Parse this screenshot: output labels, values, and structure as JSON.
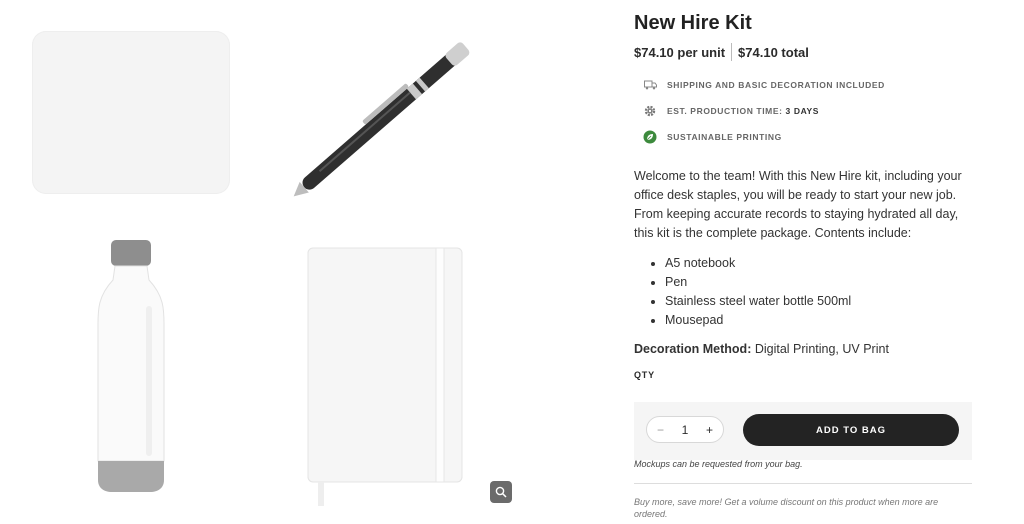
{
  "product": {
    "title": "New Hire Kit",
    "price_unit": "$74.10 per unit",
    "price_total": "$74.10 total",
    "features": [
      {
        "icon": "truck-icon",
        "text": "Shipping and basic decoration included",
        "highlight": ""
      },
      {
        "icon": "gear-icon",
        "text": "Est. production time:",
        "highlight": "3 days"
      },
      {
        "icon": "leaf-icon",
        "text": "Sustainable printing",
        "highlight": ""
      }
    ],
    "description": "Welcome to the team! With this New Hire kit, including your office desk staples, you will be ready to start your new job. From keeping accurate records to staying hydrated all day, this kit is the complete package. Contents include:",
    "contents": [
      "A5 notebook",
      "Pen",
      "Stainless steel water bottle 500ml",
      "Mousepad"
    ],
    "decoration_label": "Decoration Method:",
    "decoration_value": "Digital Printing, UV Print"
  },
  "purchase": {
    "qty_label": "QTY",
    "qty_value": "1",
    "minus": "−",
    "plus": "+",
    "add_to_bag": "ADD TO BAG",
    "mockup_note": "Mockups can be requested from your bag.",
    "volume_note": "Buy more, save more! Get a volume discount on this product when more are ordered."
  },
  "gallery": {
    "images": [
      "mousepad",
      "pen",
      "water-bottle",
      "notebook"
    ],
    "zoom_icon": "magnifier-icon"
  },
  "colors": {
    "accent": "#232323",
    "leaf": "#3d8a3d",
    "panel": "#f5f5f5"
  }
}
